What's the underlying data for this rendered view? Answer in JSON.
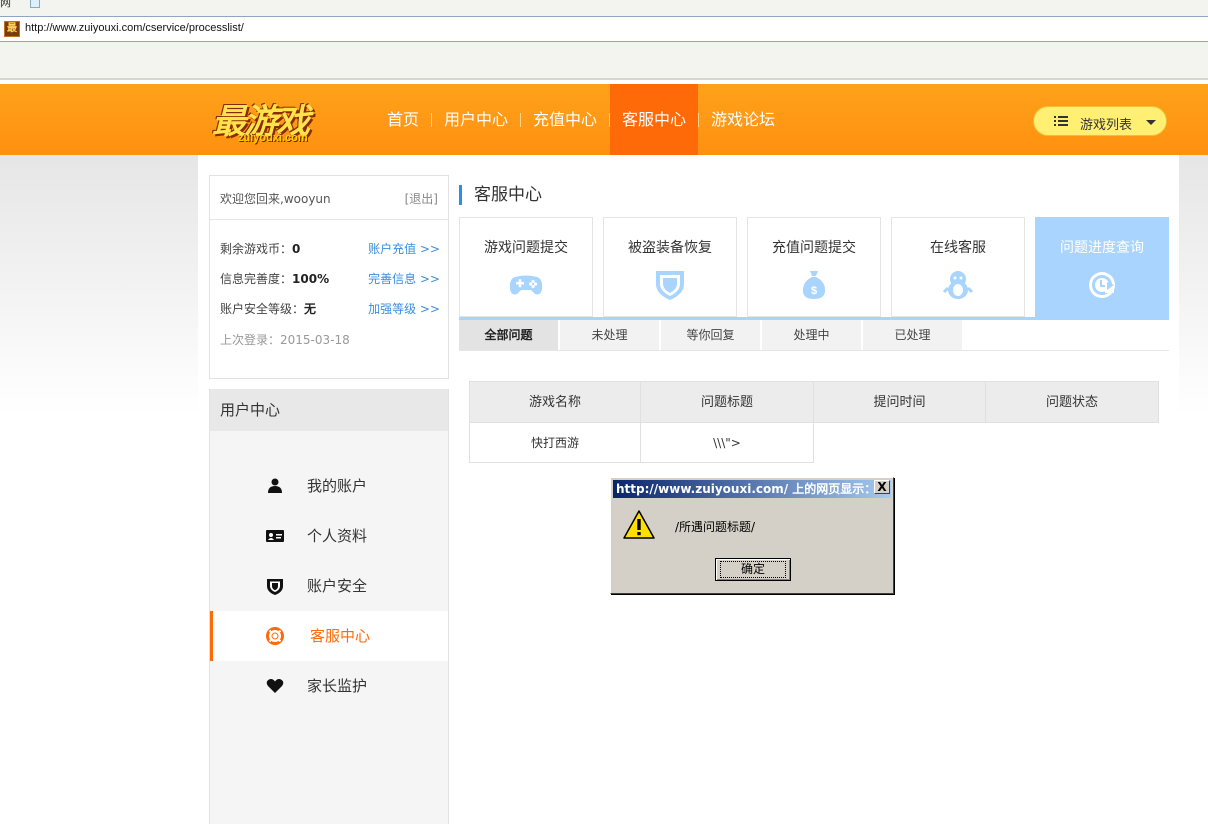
{
  "browser": {
    "url": "http://www.zuiyouxi.com/cservice/processlist/",
    "top_fragment": "网"
  },
  "header": {
    "logo_text": "最游戏",
    "logo_sub": "zuiyouxi.com",
    "nav": [
      {
        "label": "首页"
      },
      {
        "label": "用户中心"
      },
      {
        "label": "充值中心"
      },
      {
        "label": "客服中心"
      },
      {
        "label": "游戏论坛"
      }
    ],
    "games_button": "游戏列表",
    "colors": {
      "header": "#ff9a14",
      "active": "#ff6a08"
    }
  },
  "user_box": {
    "welcome": "欢迎您回来,wooyun",
    "logout": "[退出]",
    "rows": [
      {
        "label": "剩余游戏币：",
        "value": "0",
        "link": "账户充值 >>"
      },
      {
        "label": "信息完善度：",
        "value": "100%",
        "link": "完善信息 >>"
      },
      {
        "label": "账户安全等级：",
        "value": "无",
        "link": "加强等级 >>"
      }
    ],
    "last_login": "上次登录：2015-03-18"
  },
  "menu": {
    "title": "用户中心",
    "items": [
      {
        "label": "我的账户",
        "icon": "user-icon"
      },
      {
        "label": "个人资料",
        "icon": "id-card-icon"
      },
      {
        "label": "账户安全",
        "icon": "shield-icon"
      },
      {
        "label": "客服中心",
        "icon": "lifebuoy-icon"
      },
      {
        "label": "家长监护",
        "icon": "heart-icon"
      }
    ]
  },
  "main": {
    "title": "客服中心",
    "cards": [
      {
        "label": "游戏问题提交",
        "icon": "gamepad-icon"
      },
      {
        "label": "被盗装备恢复",
        "icon": "shield-icon"
      },
      {
        "label": "充值问题提交",
        "icon": "money-bag-icon"
      },
      {
        "label": "在线客服",
        "icon": "penguin-icon"
      },
      {
        "label": "问题进度查询",
        "icon": "refresh-icon"
      }
    ],
    "tabs": [
      "全部问题",
      "未处理",
      "等你回复",
      "处理中",
      "已处理"
    ],
    "table": {
      "headers": [
        "游戏名称",
        "问题标题",
        "提问时间",
        "问题状态"
      ],
      "rows": [
        [
          "快打西游",
          "\\\\\\\">",
          "",
          ""
        ]
      ]
    }
  },
  "alert": {
    "title": "http://www.zuiyouxi.com/ 上的网页显示：",
    "message": "/所遇问题标题/",
    "ok": "确定",
    "close": "X"
  }
}
